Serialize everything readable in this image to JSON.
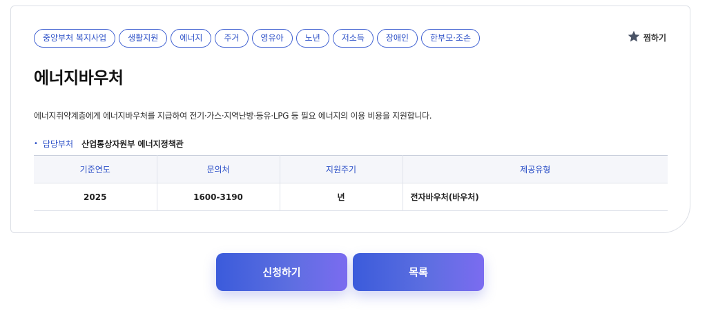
{
  "tags": [
    "중앙부처 복지사업",
    "생활지원",
    "에너지",
    "주거",
    "영유아",
    "노년",
    "저소득",
    "장애인",
    "한부모·조손"
  ],
  "bookmark": {
    "label": "찜하기",
    "icon": "star-icon"
  },
  "title": "에너지바우처",
  "description": "에너지취약계층에게 에너지바우처를 지급하여 전기·가스·지역난방·등유·LPG 등 필요 에너지의 이용 비용을 지원합니다.",
  "department": {
    "label": "담당부처",
    "value": "산업통상자원부 에너지정책관"
  },
  "table": {
    "headers": [
      "기준연도",
      "문의처",
      "지원주기",
      "제공유형"
    ],
    "row": [
      "2025",
      "1600-3190",
      "년",
      "전자바우처(바우처)"
    ]
  },
  "buttons": {
    "apply": "신청하기",
    "list": "목록"
  },
  "colors": {
    "accent": "#2b4fc7",
    "button_start": "#3b5bdb",
    "button_end": "#7b6cf0"
  }
}
